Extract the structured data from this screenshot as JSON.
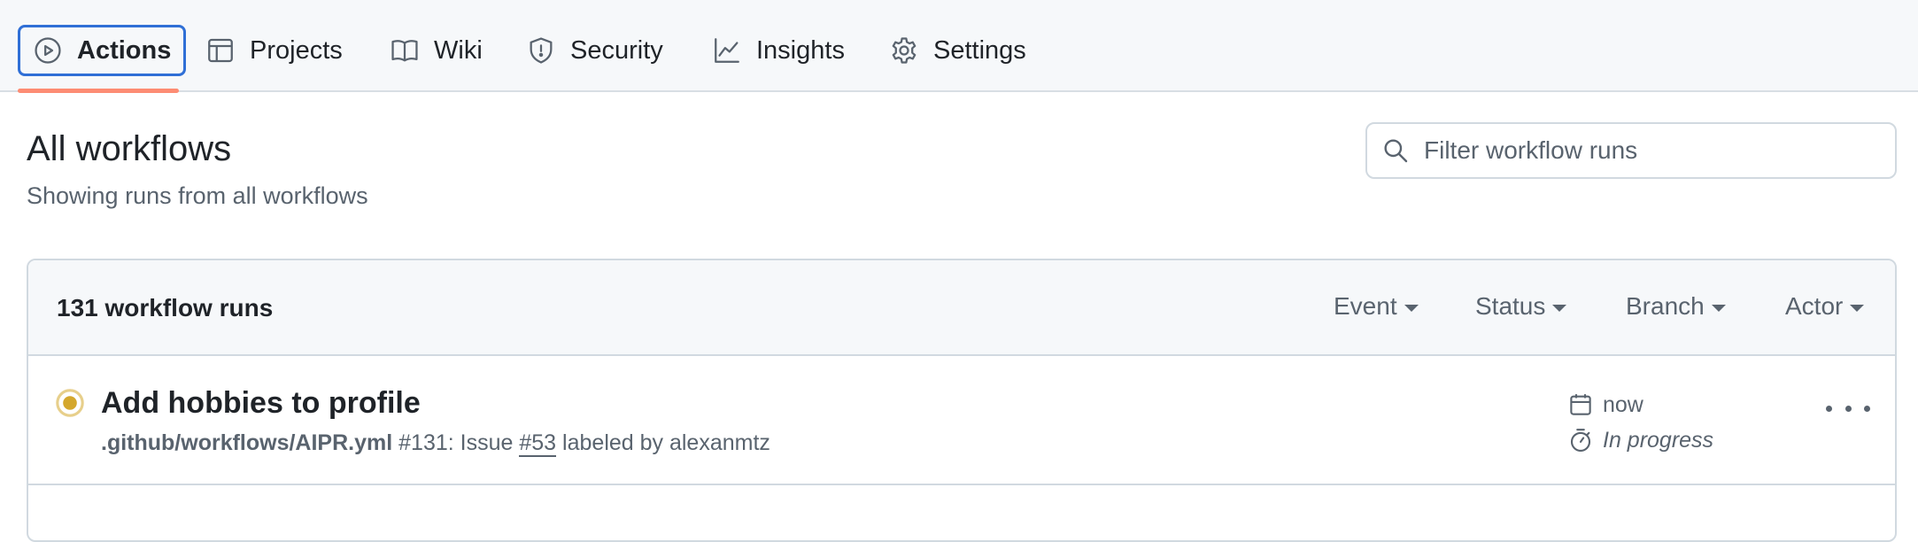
{
  "nav": {
    "tabs": [
      {
        "label": "Actions",
        "icon": "play-circle-icon",
        "active": true
      },
      {
        "label": "Projects",
        "icon": "table-icon"
      },
      {
        "label": "Wiki",
        "icon": "book-icon"
      },
      {
        "label": "Security",
        "icon": "shield-icon"
      },
      {
        "label": "Insights",
        "icon": "graph-icon"
      },
      {
        "label": "Settings",
        "icon": "gear-icon"
      }
    ]
  },
  "header": {
    "title": "All workflows",
    "subtitle": "Showing runs from all workflows"
  },
  "filter": {
    "placeholder": "Filter workflow runs",
    "value": ""
  },
  "list": {
    "count_label": "131 workflow runs",
    "filters": [
      "Event",
      "Status",
      "Branch",
      "Actor"
    ],
    "runs": [
      {
        "title": "Add hobbies to profile",
        "workflow_file": ".github/workflows/AIPR.yml",
        "run_number": "#131",
        "event_prefix": ": Issue",
        "issue": "#53",
        "event_suffix": "labeled by alexanmtz",
        "time": "now",
        "duration": "In progress",
        "status": "in-progress"
      }
    ]
  },
  "colors": {
    "accent_blue": "#2f6fd6",
    "tab_underline": "#fd8c73",
    "in_progress": "#d4a72c"
  }
}
